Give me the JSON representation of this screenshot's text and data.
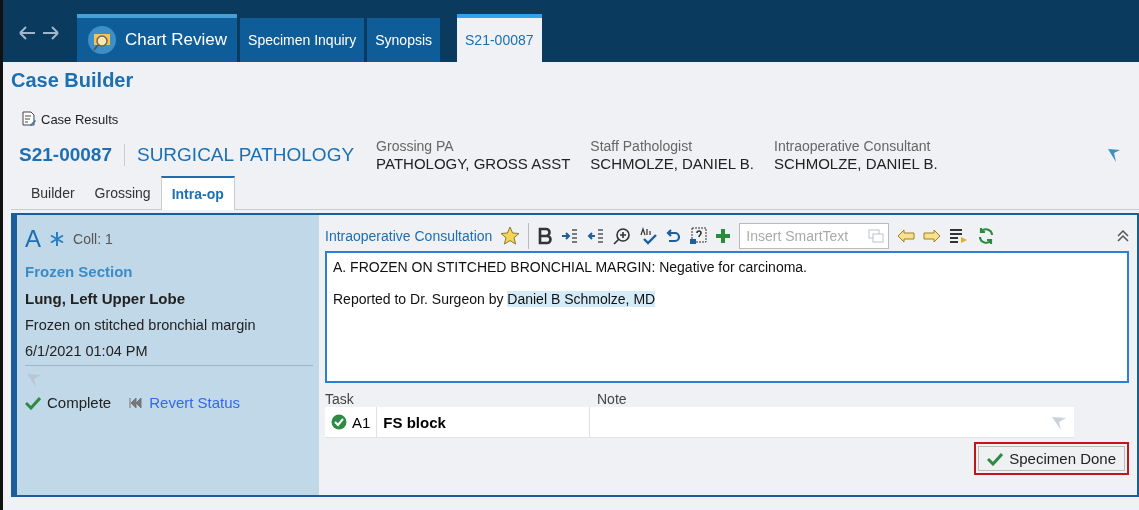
{
  "nav": {
    "tabs": [
      {
        "label": "Chart Review",
        "kind": "home",
        "selected": false
      },
      {
        "label": "Specimen Inquiry",
        "kind": "activity",
        "selected": false
      },
      {
        "label": "Synopsis",
        "kind": "activity",
        "selected": false
      },
      {
        "label": "S21-00087",
        "kind": "workspace",
        "selected": true
      }
    ]
  },
  "page": {
    "title": "Case Builder",
    "action": "Case Results"
  },
  "case": {
    "number": "S21-00087",
    "type": "SURGICAL PATHOLOGY",
    "staff": [
      {
        "role": "Grossing PA",
        "name": "PATHOLOGY, GROSS ASST"
      },
      {
        "role": "Staff Pathologist",
        "name": "SCHMOLZE, DANIEL B."
      },
      {
        "role": "Intraoperative Consultant",
        "name": "SCHMOLZE, DANIEL B."
      }
    ]
  },
  "subtabs": [
    {
      "label": "Builder",
      "selected": false
    },
    {
      "label": "Grossing",
      "selected": false
    },
    {
      "label": "Intra-op",
      "selected": true
    }
  ],
  "specimen": {
    "letter": "A",
    "collection": "Coll: 1",
    "protocol": "Frozen Section",
    "site": "Lung, Left Upper Lobe",
    "description": "Frozen on stitched bronchial margin",
    "datetime": "6/1/2021 01:04 PM",
    "status": "Complete",
    "revert": "Revert Status"
  },
  "editor": {
    "title": "Intraoperative Consultation",
    "smarttext": {
      "placeholder": "Insert SmartText"
    },
    "lines": [
      {
        "text": "A. FROZEN ON STITCHED BRONCHIAL MARGIN: Negative for carcinoma."
      },
      {
        "text": "Reported to Dr. Surgeon by ",
        "signature": "Daniel B Schmolze, MD"
      }
    ]
  },
  "tasks": {
    "columns": [
      "Task",
      "Note"
    ],
    "rows": [
      {
        "done": true,
        "code": "A1",
        "name": "FS block"
      }
    ]
  },
  "done_button": "Specimen Done"
}
